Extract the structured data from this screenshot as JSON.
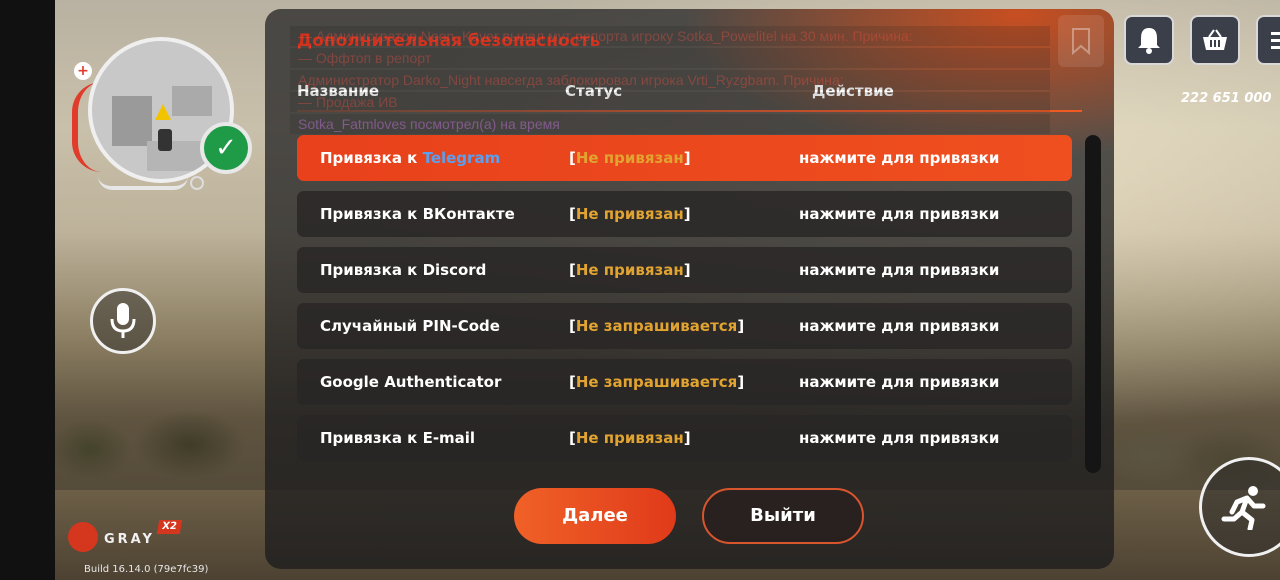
{
  "hud": {
    "money": "222 651 000",
    "build": "Build 16.14.0 (79e7fc39)",
    "logo": {
      "brand": "GRAY",
      "badge": "X2"
    }
  },
  "chat": [
    "— Администратор Neon_Kaver выдал мут репорта игроку Sotka_Powelitel на 30 мин. Причина:",
    "— Оффтоп в репорт",
    "Администратор Darko_Night навсегда заблокировал игрока Vrti_Ryzgbarn. Причина:",
    "— Продажа ИВ",
    "Sotka_Fatmloves посмотрел(а) на время"
  ],
  "panel": {
    "title": "Дополнительная безопасность",
    "columns": {
      "name": "Название",
      "status": "Статус",
      "action": "Действие"
    },
    "rows": [
      {
        "name_prefix": "Привязка к ",
        "name_highlight": "Telegram",
        "status": "Не привязан",
        "action": "нажмите для привязки",
        "active": true
      },
      {
        "name_prefix": "Привязка к ВКонтакте",
        "name_highlight": "",
        "status": "Не привязан",
        "action": "нажмите для привязки",
        "active": false
      },
      {
        "name_prefix": "Привязка к Discord",
        "name_highlight": "",
        "status": "Не привязан",
        "action": "нажмите для привязки",
        "active": false
      },
      {
        "name_prefix": "Случайный PIN-Code",
        "name_highlight": "",
        "status": "Не запрашивается",
        "action": "нажмите для привязки",
        "active": false
      },
      {
        "name_prefix": "Google Authenticator",
        "name_highlight": "",
        "status": "Не запрашивается",
        "action": "нажмите для привязки",
        "active": false
      },
      {
        "name_prefix": "Привязка к E-mail",
        "name_highlight": "",
        "status": "Не привязан",
        "action": "нажмите для привязки",
        "active": false
      }
    ],
    "buttons": {
      "next": "Далее",
      "exit": "Выйти"
    }
  },
  "icons": {
    "bell": "bell-icon",
    "shop": "basket-icon",
    "menu": "menu-icon",
    "mic": "microphone-icon",
    "run": "running-man-icon",
    "shield": "shield-check-icon",
    "bookmark": "bookmark-icon"
  },
  "colors": {
    "accent": "#f2371d",
    "status": "#e2a430",
    "telegram": "#5ba0ee"
  }
}
